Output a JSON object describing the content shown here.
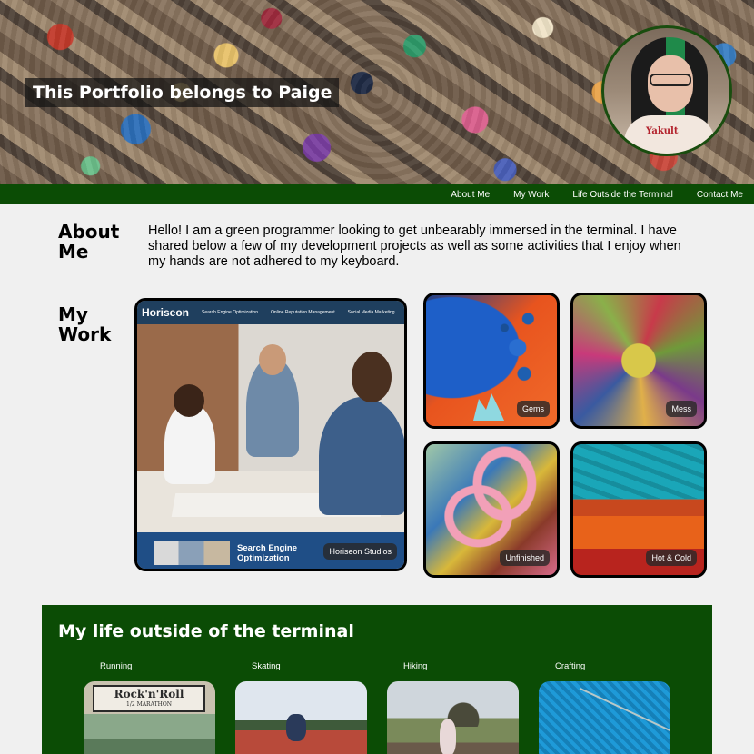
{
  "header": {
    "title": "This Portfolio belongs to Paige",
    "avatar_shirt_text": "Yakult"
  },
  "nav": {
    "items": [
      "About Me",
      "My Work",
      "Life Outside the Terminal",
      "Contact Me"
    ]
  },
  "about": {
    "heading": "About Me",
    "text": "Hello! I am a green programmer looking to get unbearably immersed in the terminal. I have shared below a few of my development projects as well as some activities that I enjoy when my hands are not adhered to my keyboard."
  },
  "work": {
    "heading": "My Work",
    "main_project": {
      "label": "Horiseon Studios",
      "logo": "Horiseon",
      "site_nav": [
        "Search Engine Optimization",
        "Online Reputation Management",
        "Social Media Marketing"
      ],
      "footer_text": "Search Engine Optimization"
    },
    "projects": [
      {
        "label": "Gems"
      },
      {
        "label": "Mess"
      },
      {
        "label": "Unfinished"
      },
      {
        "label": "Hot & Cold"
      }
    ]
  },
  "life": {
    "heading": "My life outside of the terminal",
    "activities": [
      {
        "label": "Running",
        "sign_text": "Rock'n'Roll",
        "sign_sub": "1/2 MARATHON"
      },
      {
        "label": "Skating"
      },
      {
        "label": "Hiking"
      },
      {
        "label": "Crafting"
      }
    ]
  },
  "colors": {
    "brand_green": "#0b4c05",
    "background": "#f0f0f0"
  }
}
